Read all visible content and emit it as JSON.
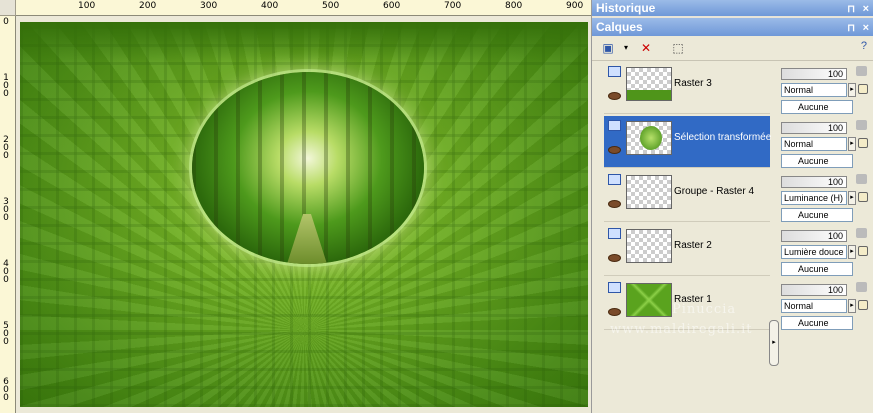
{
  "rulers": {
    "top_labels": [
      "100",
      "200",
      "300",
      "400",
      "500",
      "600",
      "700",
      "800",
      "900"
    ],
    "left_labels": [
      "0",
      "1 0 0",
      "2 0 0",
      "3 0 0",
      "4 0 0",
      "5 0 0",
      "6 0 0"
    ]
  },
  "panels": {
    "history_title": "Historique",
    "layers_title": "Calques",
    "pin_glyph": "⊓",
    "close_glyph": "×"
  },
  "layers": [
    {
      "name": "Raster 3",
      "opacity": "100",
      "blend": "Normal",
      "mode": "Aucune",
      "selected": false,
      "thumb": "strip"
    },
    {
      "name": "Sélection transformée",
      "opacity": "100",
      "blend": "Normal",
      "mode": "Aucune",
      "selected": true,
      "thumb": "ball"
    },
    {
      "name": "Groupe - Raster 4",
      "opacity": "100",
      "blend": "Luminance (H)",
      "mode": "Aucune",
      "selected": false,
      "thumb": "plain"
    },
    {
      "name": "Raster 2",
      "opacity": "100",
      "blend": "Lumière douce",
      "mode": "Aucune",
      "selected": false,
      "thumb": "plain"
    },
    {
      "name": "Raster 1",
      "opacity": "100",
      "blend": "Normal",
      "mode": "Aucune",
      "selected": false,
      "thumb": "green"
    }
  ],
  "watermark": {
    "line1": "Pinuccia",
    "line2": "www.maldiregali.it"
  },
  "colors": {
    "selection": "#316ac5",
    "panel_title": "#7aa2dc",
    "canvas_green": "#6fae23"
  }
}
